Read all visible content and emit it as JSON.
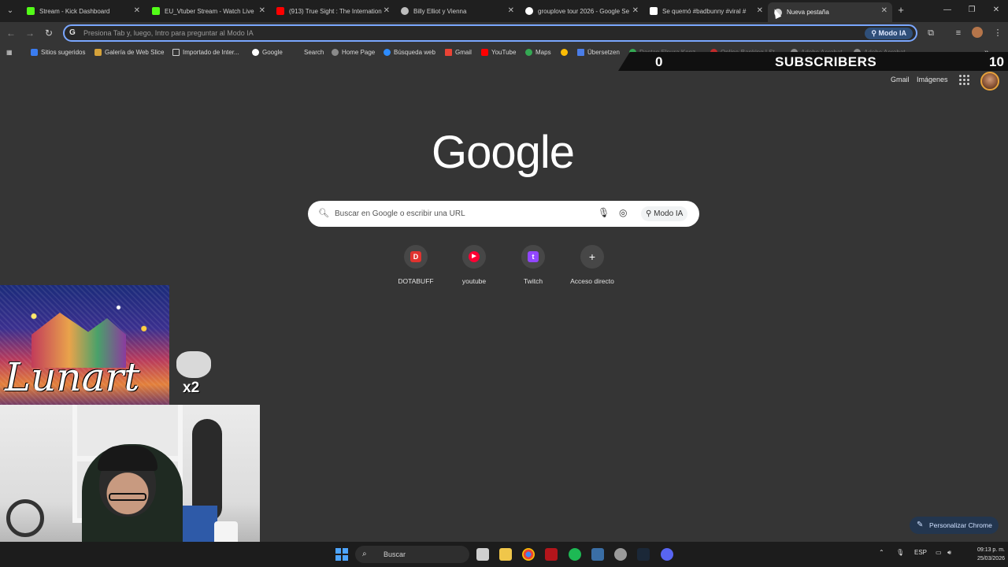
{
  "browser": {
    "tabs": [
      {
        "title": "Stream - Kick Dashboard",
        "icon": "kick-icon",
        "color": "#53fc18"
      },
      {
        "title": "EU_Vtuber Stream - Watch Live",
        "icon": "kick-icon",
        "color": "#53fc18"
      },
      {
        "title": "(913) True Sight : The Internation",
        "icon": "youtube-icon",
        "color": "#ff0000"
      },
      {
        "title": "Billy Elliot y Vienna",
        "icon": "chatgpt-icon",
        "color": "#bdbdbd"
      },
      {
        "title": "grouplove tour 2026 - Google Se",
        "icon": "google-icon",
        "color": "#ffffff"
      },
      {
        "title": "Se quemó #badbunny #viral #",
        "icon": "tiktok-icon",
        "color": "#ffffff"
      },
      {
        "title": "Nueva pestaña",
        "icon": "chrome-icon",
        "color": "#cfcfcf",
        "active": true
      }
    ],
    "omnibox_placeholder": "Presiona Tab y, luego, Intro para preguntar al Modo IA",
    "omnibox_modo": "Modo IA",
    "bookmarks": [
      "Sitios sugeridos",
      "Galería de Web Slice",
      "Importado de Inter...",
      "Google",
      "Search",
      "Home Page",
      "Búsqueda web",
      "Gmail",
      "YouTube",
      "Maps",
      "",
      "Übersetzen",
      "Dastan Elnura Kenz...",
      "Online-Banking | St...",
      "Adobe Acrobat",
      "Adobe Acrobat"
    ],
    "bookmarks_more": "»"
  },
  "overlay": {
    "sub_left": "0",
    "sub_label": "SUBSCRIBERS",
    "sub_right": "10",
    "artwork_signature": "Lunart",
    "cat_multiplier": "x2"
  },
  "newtab": {
    "links": [
      "Gmail",
      "Imágenes"
    ],
    "logo": "Google",
    "search_placeholder": "Buscar en Google o escribir una URL",
    "search_modo": "Modo IA",
    "shortcuts": [
      {
        "label": "DOTABUFF",
        "glyph": "D",
        "color": "#e0332f"
      },
      {
        "label": "youtube",
        "glyph": "▶",
        "color": "#ff0033"
      },
      {
        "label": "Twitch",
        "glyph": "t",
        "color": "#9146ff"
      },
      {
        "label": "Acceso directo",
        "glyph": "+",
        "color": "#474747"
      }
    ],
    "customize": "Personalizar Chrome"
  },
  "taskbar": {
    "search": "Buscar",
    "lang": "ESP",
    "time": "09:13 p. m.",
    "date": "25/03/2026"
  },
  "colors": {
    "accent": "#7aa7ff",
    "background": "#353535",
    "tabstrip": "#1f1f1f"
  }
}
